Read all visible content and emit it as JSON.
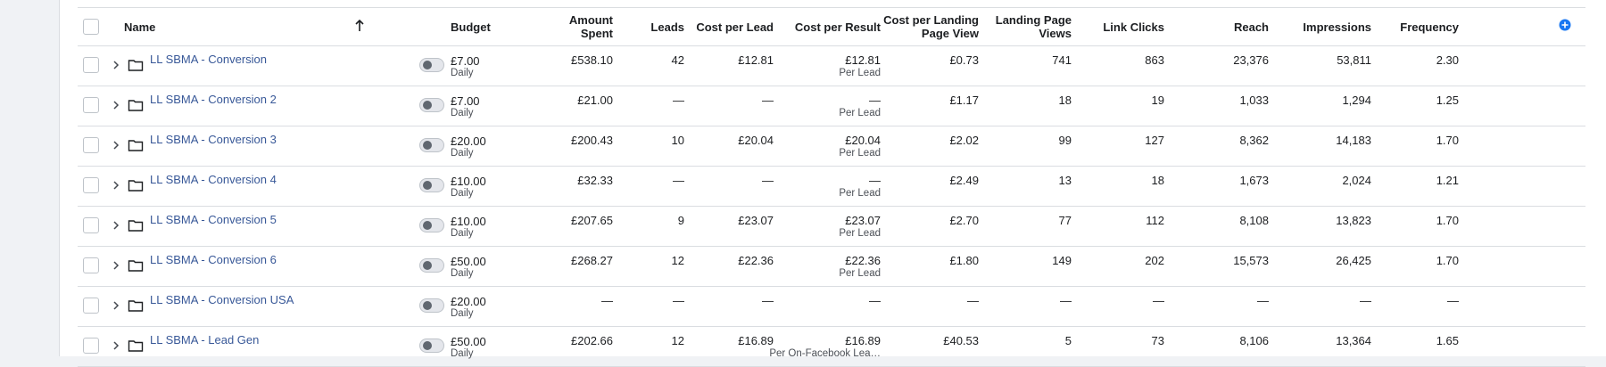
{
  "table": {
    "columns": {
      "name": "Name",
      "budget": "Budget",
      "amount_spent_1": "Amount",
      "amount_spent_2": "Spent",
      "leads": "Leads",
      "cost_per_lead": "Cost per Lead",
      "cost_per_result": "Cost per Result",
      "cplpv_1": "Cost per Landing",
      "cplpv_2": "Page View",
      "lpv_1": "Landing Page",
      "lpv_2": "Views",
      "link_clicks": "Link Clicks",
      "reach": "Reach",
      "impressions": "Impressions",
      "frequency": "Frequency"
    },
    "rows": [
      {
        "name": "LL SBMA - Conversion",
        "budget": "£7.00",
        "budget_type": "Daily",
        "amount_spent": "£538.10",
        "leads": "42",
        "cost_per_lead": "£12.81",
        "cost_per_result": "£12.81",
        "result_type": "Per Lead",
        "cplpv": "£0.73",
        "lpv": "741",
        "link_clicks": "863",
        "reach": "23,376",
        "impressions": "53,811",
        "frequency": "2.30"
      },
      {
        "name": "LL SBMA - Conversion 2",
        "budget": "£7.00",
        "budget_type": "Daily",
        "amount_spent": "£21.00",
        "leads": "—",
        "cost_per_lead": "—",
        "cost_per_result": "—",
        "result_type": "Per Lead",
        "cplpv": "£1.17",
        "lpv": "18",
        "link_clicks": "19",
        "reach": "1,033",
        "impressions": "1,294",
        "frequency": "1.25"
      },
      {
        "name": "LL SBMA - Conversion 3",
        "budget": "£20.00",
        "budget_type": "Daily",
        "amount_spent": "£200.43",
        "leads": "10",
        "cost_per_lead": "£20.04",
        "cost_per_result": "£20.04",
        "result_type": "Per Lead",
        "cplpv": "£2.02",
        "lpv": "99",
        "link_clicks": "127",
        "reach": "8,362",
        "impressions": "14,183",
        "frequency": "1.70"
      },
      {
        "name": "LL SBMA - Conversion 4",
        "budget": "£10.00",
        "budget_type": "Daily",
        "amount_spent": "£32.33",
        "leads": "—",
        "cost_per_lead": "—",
        "cost_per_result": "—",
        "result_type": "Per Lead",
        "cplpv": "£2.49",
        "lpv": "13",
        "link_clicks": "18",
        "reach": "1,673",
        "impressions": "2,024",
        "frequency": "1.21"
      },
      {
        "name": "LL SBMA - Conversion 5",
        "budget": "£10.00",
        "budget_type": "Daily",
        "amount_spent": "£207.65",
        "leads": "9",
        "cost_per_lead": "£23.07",
        "cost_per_result": "£23.07",
        "result_type": "Per Lead",
        "cplpv": "£2.70",
        "lpv": "77",
        "link_clicks": "112",
        "reach": "8,108",
        "impressions": "13,823",
        "frequency": "1.70"
      },
      {
        "name": "LL SBMA - Conversion 6",
        "budget": "£50.00",
        "budget_type": "Daily",
        "amount_spent": "£268.27",
        "leads": "12",
        "cost_per_lead": "£22.36",
        "cost_per_result": "£22.36",
        "result_type": "Per Lead",
        "cplpv": "£1.80",
        "lpv": "149",
        "link_clicks": "202",
        "reach": "15,573",
        "impressions": "26,425",
        "frequency": "1.70"
      },
      {
        "name": "LL SBMA - Conversion USA",
        "budget": "£20.00",
        "budget_type": "Daily",
        "amount_spent": "—",
        "leads": "—",
        "cost_per_lead": "—",
        "cost_per_result": "—",
        "result_type": "",
        "cplpv": "—",
        "lpv": "—",
        "link_clicks": "—",
        "reach": "—",
        "impressions": "—",
        "frequency": "—"
      },
      {
        "name": "LL SBMA - Lead Gen",
        "budget": "£50.00",
        "budget_type": "Daily",
        "amount_spent": "£202.66",
        "leads": "12",
        "cost_per_lead": "£16.89",
        "cost_per_result": "£16.89",
        "result_type": "Per On-Facebook Lea…",
        "cplpv": "£40.53",
        "lpv": "5",
        "link_clicks": "73",
        "reach": "8,106",
        "impressions": "13,364",
        "frequency": "1.65"
      }
    ]
  },
  "colors": {
    "link": "#385898",
    "accent": "#1877f2",
    "border": "#dadde1"
  },
  "icons": {
    "sort": "arrow-up-icon",
    "add_column": "plus-circle-icon",
    "expand": "chevron-right-icon",
    "folder": "folder-icon"
  }
}
